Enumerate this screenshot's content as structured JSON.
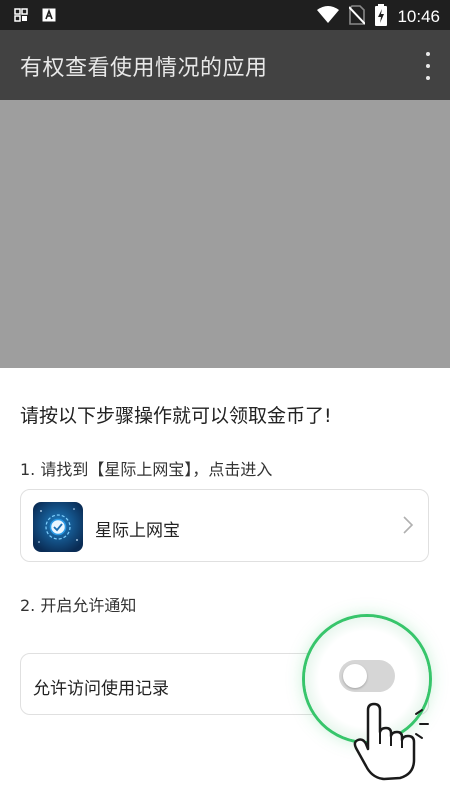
{
  "status_bar": {
    "time": "10:46",
    "left_icons": [
      "screenshot-icon",
      "font-icon"
    ],
    "right_icons": [
      "wifi-icon",
      "no-sim-icon",
      "battery-charging-icon"
    ]
  },
  "app_bar": {
    "title": "有权查看使用情况的应用",
    "menu_icon": "more-vert-icon"
  },
  "sheet": {
    "heading": "请按以下步骤操作就可以领取金币了!",
    "step1": "1. 请找到【星际上网宝】，点击进入",
    "app": {
      "name": "星际上网宝",
      "icon": "app-logo-icon"
    },
    "step2": "2. 开启允许通知",
    "permission": {
      "label": "允许访问使用记录",
      "enabled": false
    }
  },
  "colors": {
    "status_bar": "#1f1f1f",
    "app_bar": "#424242",
    "overlay": "#9e9e9e",
    "highlight_ring": "#37c56b"
  }
}
